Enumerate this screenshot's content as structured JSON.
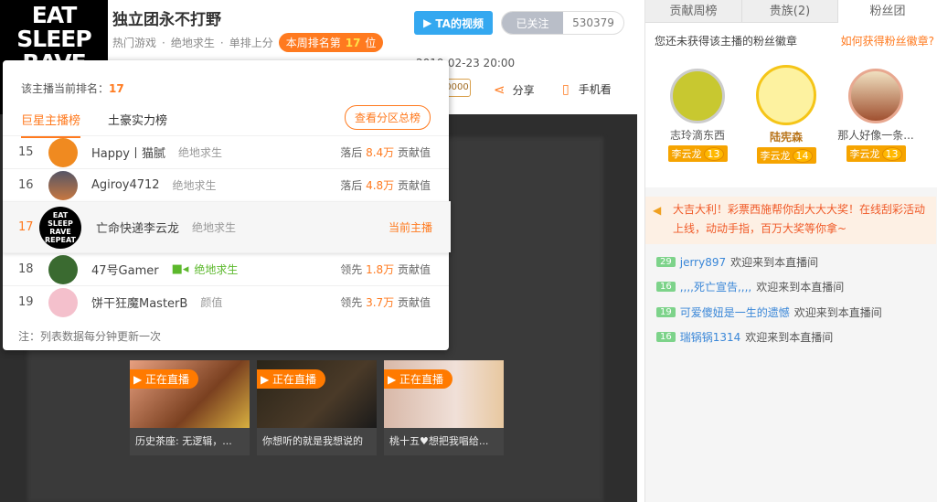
{
  "header": {
    "avatar_text": "EAT SLEEP RAVE",
    "title": "独立团永不打野",
    "tags": [
      "热门游戏",
      "绝地求生",
      "单排上分"
    ],
    "weekly_rank_prefix": "本周排名第",
    "weekly_rank": "17",
    "weekly_rank_suffix": "位",
    "ta_video": "TA的视频",
    "followed": "已关注",
    "follower_count": "530379",
    "time": "2019-02-23 20:00",
    "gift_value": "0000",
    "share": "分享",
    "mobile": "手机看"
  },
  "popup": {
    "current_rank_label": "该主播当前排名：",
    "current_rank": "17",
    "tabs": [
      "巨星主播榜",
      "土豪实力榜"
    ],
    "view_all": "查看分区总榜",
    "rows": [
      {
        "rank": "15",
        "name": "Happy丨猫腻",
        "category": "绝地求生",
        "status": "落后",
        "value": "8.4万",
        "unit": "贡献值"
      },
      {
        "rank": "16",
        "name": "Agiroy4712",
        "category": "绝地求生",
        "status": "落后",
        "value": "4.8万",
        "unit": "贡献值"
      },
      {
        "rank": "17",
        "name": "亡命快递李云龙",
        "category": "绝地求生",
        "current": "当前主播",
        "avatar_text": "EAT SLEEP RAVE REPEAT"
      },
      {
        "rank": "18",
        "name": "47号Gamer",
        "category": "绝地求生",
        "status": "领先",
        "value": "1.8万",
        "unit": "贡献值"
      },
      {
        "rank": "19",
        "name": "饼干狂魔MasterB",
        "category": "颜值",
        "status": "领先",
        "value": "3.7万",
        "unit": "贡献值"
      }
    ],
    "note": "注：列表数据每分钟更新一次"
  },
  "recommend": [
    {
      "live": "正在直播",
      "caption": "历史茶座: 无逻辑，..."
    },
    {
      "live": "正在直播",
      "caption": "你想听的就是我想说的"
    },
    {
      "live": "正在直播",
      "caption": "桃十五♥想把我唱给..."
    }
  ],
  "right": {
    "tabs": [
      "贡献周榜",
      "贵族(2)",
      "粉丝团"
    ],
    "fan_hint": "您还未获得该主播的粉丝徽章",
    "fan_how": "如何获得粉丝徽章?",
    "fans": [
      {
        "name": "志玲滴东西",
        "badge": "李云龙",
        "level": "13"
      },
      {
        "name": "陆宪森",
        "badge": "李云龙",
        "level": "14"
      },
      {
        "name": "那人好像一条...",
        "badge": "李云龙",
        "level": "13"
      }
    ],
    "announce": "大吉大利！彩票西施帮你刮大大大奖！在线刮彩活动上线，动动手指，百万大奖等你拿~",
    "messages": [
      {
        "level": "29",
        "user": "jerry897",
        "text": "欢迎来到本直播间"
      },
      {
        "level": "16",
        "user": ",,,,死亡宣告,,,,",
        "text": "欢迎来到本直播间"
      },
      {
        "level": "19",
        "user": "可爱傻妞是一生的遗憾",
        "text": "欢迎来到本直播间"
      },
      {
        "level": "16",
        "user": "瑞锅锅1314",
        "text": "欢迎来到本直播间"
      }
    ]
  }
}
